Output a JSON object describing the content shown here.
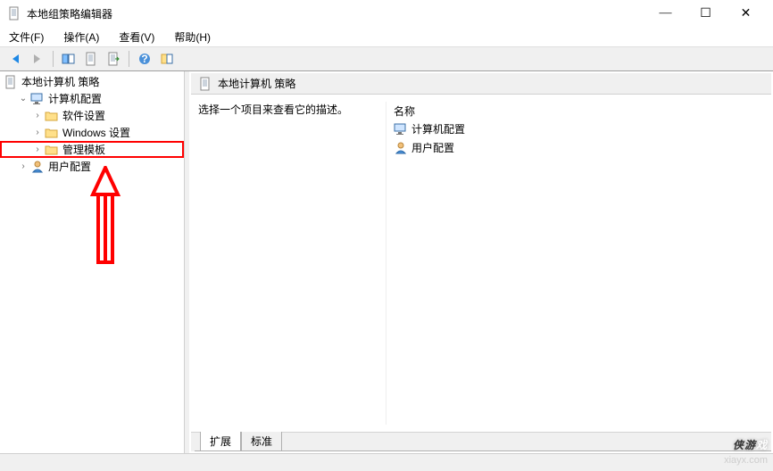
{
  "window": {
    "title": "本地组策略编辑器"
  },
  "menu": {
    "file": "文件(F)",
    "action": "操作(A)",
    "view": "查看(V)",
    "help": "帮助(H)"
  },
  "tree": {
    "root": "本地计算机 策略",
    "computer_config": "计算机配置",
    "software_settings": "软件设置",
    "windows_settings": "Windows 设置",
    "admin_templates": "管理模板",
    "user_config": "用户配置"
  },
  "content": {
    "header": "本地计算机 策略",
    "hint": "选择一个项目来查看它的描述。",
    "col_name": "名称",
    "items": {
      "computer_config": "计算机配置",
      "user_config": "用户配置"
    }
  },
  "tabs": {
    "extended": "扩展",
    "standard": "标准"
  },
  "watermark": {
    "brand_left": "侠游",
    "brand_right": "戏",
    "url": "xiayx.com"
  }
}
